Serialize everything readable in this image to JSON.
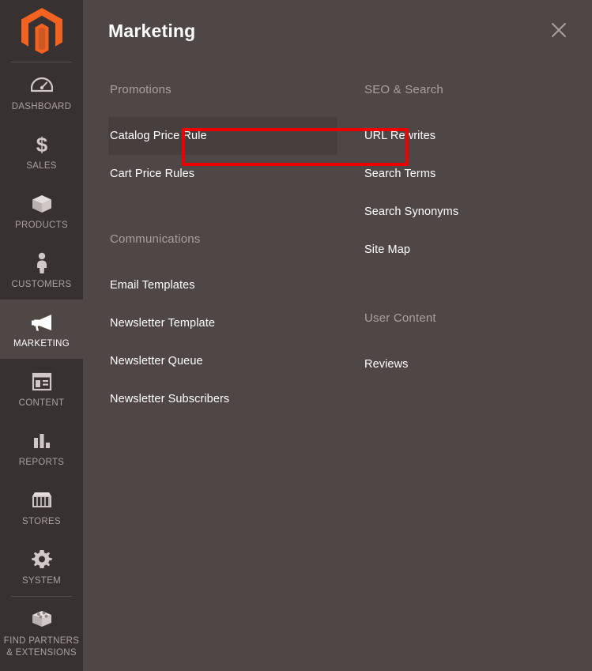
{
  "sidebar": {
    "logo": {
      "icon": "magento-logo-icon",
      "color": "#f26322"
    },
    "items": [
      {
        "label": "DASHBOARD",
        "icon": "dashboard-gauge-icon",
        "active": false
      },
      {
        "label": "SALES",
        "icon": "dollar-sign-icon",
        "active": false
      },
      {
        "label": "PRODUCTS",
        "icon": "box-package-icon",
        "active": false
      },
      {
        "label": "CUSTOMERS",
        "icon": "person-icon",
        "active": false
      },
      {
        "label": "MARKETING",
        "icon": "megaphone-icon",
        "active": true
      },
      {
        "label": "CONTENT",
        "icon": "layout-page-icon",
        "active": false
      },
      {
        "label": "REPORTS",
        "icon": "bar-chart-icon",
        "active": false
      },
      {
        "label": "STORES",
        "icon": "storefront-icon",
        "active": false
      },
      {
        "label": "SYSTEM",
        "icon": "gear-icon",
        "active": false
      },
      {
        "label": "FIND PARTNERS\n& EXTENSIONS",
        "label_line1": "FIND PARTNERS",
        "label_line2": "& EXTENSIONS",
        "icon": "extension-blocks-icon",
        "active": false
      }
    ]
  },
  "panel": {
    "title": "Marketing",
    "close_icon": "close-x-icon",
    "columns": [
      {
        "groups": [
          {
            "title": "Promotions",
            "items": [
              {
                "label": "Catalog Price Rule",
                "highlighted": true,
                "hovered": true
              },
              {
                "label": "Cart Price Rules",
                "highlighted": false,
                "hovered": false
              }
            ]
          },
          {
            "title": "Communications",
            "items": [
              {
                "label": "Email Templates",
                "highlighted": false,
                "hovered": false
              },
              {
                "label": "Newsletter Template",
                "highlighted": false,
                "hovered": false
              },
              {
                "label": "Newsletter Queue",
                "highlighted": false,
                "hovered": false
              },
              {
                "label": "Newsletter Subscribers",
                "highlighted": false,
                "hovered": false
              }
            ]
          }
        ]
      },
      {
        "groups": [
          {
            "title": "SEO & Search",
            "items": [
              {
                "label": "URL Rewrites",
                "highlighted": false,
                "hovered": false
              },
              {
                "label": "Search Terms",
                "highlighted": false,
                "hovered": false
              },
              {
                "label": "Search Synonyms",
                "highlighted": false,
                "hovered": false
              },
              {
                "label": "Site Map",
                "highlighted": false,
                "hovered": false
              }
            ]
          },
          {
            "title": "User Content",
            "items": [
              {
                "label": "Reviews",
                "highlighted": false,
                "hovered": false
              }
            ]
          }
        ]
      }
    ]
  },
  "annotation": {
    "color": "#ee0000",
    "target_label": "Catalog Price Rule"
  },
  "colors": {
    "sidebar_bg": "#373231",
    "panel_bg": "#4f4745",
    "heading_text": "#a8a19f",
    "item_text": "#ffffff",
    "brand_orange": "#f26322",
    "hover_bg": "#463f3d"
  }
}
